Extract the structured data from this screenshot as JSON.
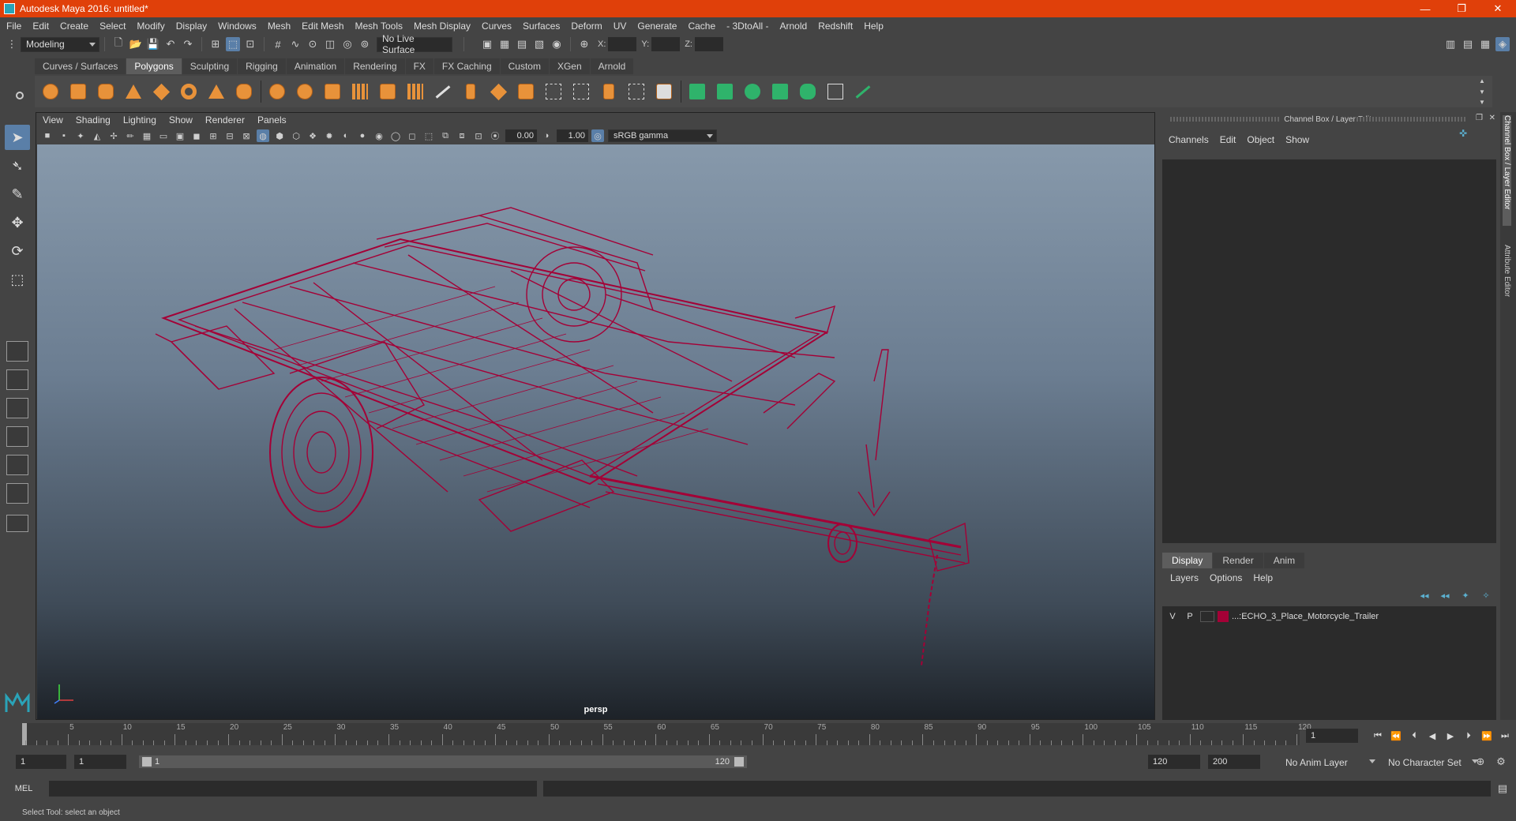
{
  "window": {
    "title": "Autodesk Maya 2016: untitled*",
    "minimize": "—",
    "maximize": "❐",
    "close": "✕"
  },
  "menubar": [
    "File",
    "Edit",
    "Create",
    "Select",
    "Modify",
    "Display",
    "Windows",
    "Mesh",
    "Edit Mesh",
    "Mesh Tools",
    "Mesh Display",
    "Curves",
    "Surfaces",
    "Deform",
    "UV",
    "Generate",
    "Cache",
    "- 3DtoAll -",
    "Arnold",
    "Redshift",
    "Help"
  ],
  "statusline": {
    "menuset": "Modeling",
    "live_surface": "No Live Surface",
    "x_label": "X:",
    "y_label": "Y:",
    "z_label": "Z:"
  },
  "shelf_tabs": [
    "Curves / Surfaces",
    "Polygons",
    "Sculpting",
    "Rigging",
    "Animation",
    "Rendering",
    "FX",
    "FX Caching",
    "Custom",
    "XGen",
    "Arnold"
  ],
  "shelf_active_tab": "Polygons",
  "viewport": {
    "panel_menu": [
      "View",
      "Shading",
      "Lighting",
      "Show",
      "Renderer",
      "Panels"
    ],
    "exposure": "0.00",
    "gamma": "1.00",
    "color_space": "sRGB gamma",
    "camera": "persp",
    "wire_color": "#a40036"
  },
  "channel_box": {
    "title": "Channel Box / Layer Editor",
    "menu": [
      "Channels",
      "Edit",
      "Object",
      "Show"
    ]
  },
  "layer_editor": {
    "tabs": [
      "Display",
      "Render",
      "Anim"
    ],
    "menu": [
      "Layers",
      "Options",
      "Help"
    ],
    "layers": [
      {
        "v": "V",
        "p": "P",
        "color": "#a40036",
        "name": "...:ECHO_3_Place_Motorcycle_Trailer"
      }
    ]
  },
  "side_tabs": [
    "Channel Box / Layer Editor",
    "Attribute Editor"
  ],
  "timeline": {
    "ticks": [
      5,
      10,
      15,
      20,
      25,
      30,
      35,
      40,
      45,
      50,
      55,
      60,
      65,
      70,
      75,
      80,
      85,
      90,
      95,
      100,
      105,
      110,
      115,
      120
    ],
    "start_label": "1",
    "current_frame": "1",
    "min_frame": 1,
    "max_frame": 120
  },
  "range": {
    "start": "1",
    "inner_start": "1",
    "slider_start": "1",
    "slider_end": "120",
    "end": "120",
    "outer_end": "200",
    "anim_layer": "No Anim Layer",
    "character_set": "No Character Set"
  },
  "command_line": {
    "label": "MEL"
  },
  "help_line": "Select Tool: select an object"
}
